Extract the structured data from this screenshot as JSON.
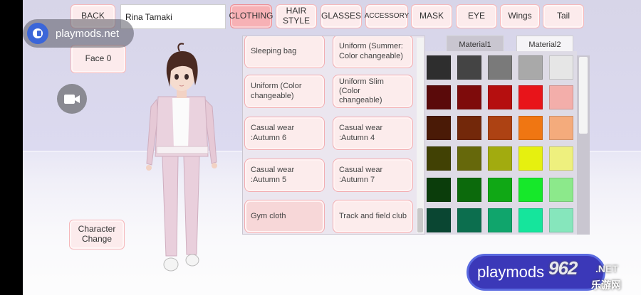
{
  "top_buttons": {
    "back": "BACK",
    "name_value": "Rina Tamaki",
    "tabs": [
      {
        "label": "CLOTHING",
        "selected": true
      },
      {
        "label": "HAIR\nSTYLE",
        "selected": false
      },
      {
        "label": "GLASSES",
        "selected": false
      },
      {
        "label": "ACCESSORY",
        "selected": false
      },
      {
        "label": "MASK",
        "selected": false
      },
      {
        "label": "EYE",
        "selected": false
      },
      {
        "label": "Wings",
        "selected": false
      },
      {
        "label": "Tail",
        "selected": false
      }
    ]
  },
  "left": {
    "face_button": "Face 0",
    "character_change": "Character\nChange"
  },
  "clothing_items": [
    "Sleeping bag",
    "Uniform (Summer:\nColor changeable)",
    "Uniform (Color\nchangeable)",
    "Uniform Slim (Color\nchangeable)",
    "Casual wear\n:Autumn 6",
    "Casual wear\n:Autumn 4",
    "Casual wear\n:Autumn 5",
    "Casual wear\n:Autumn 7",
    "Gym cloth",
    "Track and field club"
  ],
  "material_tabs": [
    {
      "label": "Material1",
      "active": false
    },
    {
      "label": "Material2",
      "active": true
    }
  ],
  "palette": [
    [
      "#2e2e2e",
      "#444444",
      "#7a7a7a",
      "#a9a9a9",
      "#e6e6e6"
    ],
    [
      "#5a0a0a",
      "#7e0b0b",
      "#b50f0f",
      "#e8141a",
      "#f3aeaa"
    ],
    [
      "#4a1a06",
      "#73280a",
      "#ad4213",
      "#f07612",
      "#f4ab7c"
    ],
    [
      "#414104",
      "#66680b",
      "#a2ab0f",
      "#e6f00f",
      "#eef07e"
    ],
    [
      "#0b3d0b",
      "#0c6a0c",
      "#10a815",
      "#16e82a",
      "#8ce98b"
    ],
    [
      "#0a4632",
      "#0c6e4e",
      "#10a56c",
      "#15e59c",
      "#86e6bc"
    ]
  ],
  "watermarks": {
    "top": "playmods.net",
    "bottom": "playmods",
    "site_number": "962",
    "site_net": ".NET",
    "site_cn": "乐游网"
  }
}
